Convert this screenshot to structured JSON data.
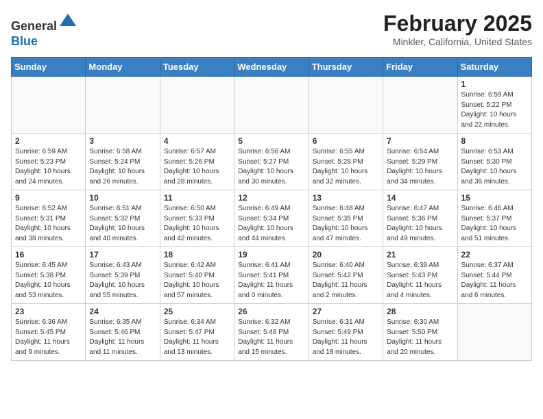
{
  "header": {
    "logo_general": "General",
    "logo_blue": "Blue",
    "month_title": "February 2025",
    "location": "Minkler, California, United States"
  },
  "days_of_week": [
    "Sunday",
    "Monday",
    "Tuesday",
    "Wednesday",
    "Thursday",
    "Friday",
    "Saturday"
  ],
  "weeks": [
    [
      {
        "day": "",
        "info": ""
      },
      {
        "day": "",
        "info": ""
      },
      {
        "day": "",
        "info": ""
      },
      {
        "day": "",
        "info": ""
      },
      {
        "day": "",
        "info": ""
      },
      {
        "day": "",
        "info": ""
      },
      {
        "day": "1",
        "info": "Sunrise: 6:59 AM\nSunset: 5:22 PM\nDaylight: 10 hours and 22 minutes."
      }
    ],
    [
      {
        "day": "2",
        "info": "Sunrise: 6:59 AM\nSunset: 5:23 PM\nDaylight: 10 hours and 24 minutes."
      },
      {
        "day": "3",
        "info": "Sunrise: 6:58 AM\nSunset: 5:24 PM\nDaylight: 10 hours and 26 minutes."
      },
      {
        "day": "4",
        "info": "Sunrise: 6:57 AM\nSunset: 5:26 PM\nDaylight: 10 hours and 28 minutes."
      },
      {
        "day": "5",
        "info": "Sunrise: 6:56 AM\nSunset: 5:27 PM\nDaylight: 10 hours and 30 minutes."
      },
      {
        "day": "6",
        "info": "Sunrise: 6:55 AM\nSunset: 5:28 PM\nDaylight: 10 hours and 32 minutes."
      },
      {
        "day": "7",
        "info": "Sunrise: 6:54 AM\nSunset: 5:29 PM\nDaylight: 10 hours and 34 minutes."
      },
      {
        "day": "8",
        "info": "Sunrise: 6:53 AM\nSunset: 5:30 PM\nDaylight: 10 hours and 36 minutes."
      }
    ],
    [
      {
        "day": "9",
        "info": "Sunrise: 6:52 AM\nSunset: 5:31 PM\nDaylight: 10 hours and 38 minutes."
      },
      {
        "day": "10",
        "info": "Sunrise: 6:51 AM\nSunset: 5:32 PM\nDaylight: 10 hours and 40 minutes."
      },
      {
        "day": "11",
        "info": "Sunrise: 6:50 AM\nSunset: 5:33 PM\nDaylight: 10 hours and 42 minutes."
      },
      {
        "day": "12",
        "info": "Sunrise: 6:49 AM\nSunset: 5:34 PM\nDaylight: 10 hours and 44 minutes."
      },
      {
        "day": "13",
        "info": "Sunrise: 6:48 AM\nSunset: 5:35 PM\nDaylight: 10 hours and 47 minutes."
      },
      {
        "day": "14",
        "info": "Sunrise: 6:47 AM\nSunset: 5:36 PM\nDaylight: 10 hours and 49 minutes."
      },
      {
        "day": "15",
        "info": "Sunrise: 6:46 AM\nSunset: 5:37 PM\nDaylight: 10 hours and 51 minutes."
      }
    ],
    [
      {
        "day": "16",
        "info": "Sunrise: 6:45 AM\nSunset: 5:38 PM\nDaylight: 10 hours and 53 minutes."
      },
      {
        "day": "17",
        "info": "Sunrise: 6:43 AM\nSunset: 5:39 PM\nDaylight: 10 hours and 55 minutes."
      },
      {
        "day": "18",
        "info": "Sunrise: 6:42 AM\nSunset: 5:40 PM\nDaylight: 10 hours and 57 minutes."
      },
      {
        "day": "19",
        "info": "Sunrise: 6:41 AM\nSunset: 5:41 PM\nDaylight: 11 hours and 0 minutes."
      },
      {
        "day": "20",
        "info": "Sunrise: 6:40 AM\nSunset: 5:42 PM\nDaylight: 11 hours and 2 minutes."
      },
      {
        "day": "21",
        "info": "Sunrise: 6:39 AM\nSunset: 5:43 PM\nDaylight: 11 hours and 4 minutes."
      },
      {
        "day": "22",
        "info": "Sunrise: 6:37 AM\nSunset: 5:44 PM\nDaylight: 11 hours and 6 minutes."
      }
    ],
    [
      {
        "day": "23",
        "info": "Sunrise: 6:36 AM\nSunset: 5:45 PM\nDaylight: 11 hours and 9 minutes."
      },
      {
        "day": "24",
        "info": "Sunrise: 6:35 AM\nSunset: 5:46 PM\nDaylight: 11 hours and 11 minutes."
      },
      {
        "day": "25",
        "info": "Sunrise: 6:34 AM\nSunset: 5:47 PM\nDaylight: 11 hours and 13 minutes."
      },
      {
        "day": "26",
        "info": "Sunrise: 6:32 AM\nSunset: 5:48 PM\nDaylight: 11 hours and 15 minutes."
      },
      {
        "day": "27",
        "info": "Sunrise: 6:31 AM\nSunset: 5:49 PM\nDaylight: 11 hours and 18 minutes."
      },
      {
        "day": "28",
        "info": "Sunrise: 6:30 AM\nSunset: 5:50 PM\nDaylight: 11 hours and 20 minutes."
      },
      {
        "day": "",
        "info": ""
      }
    ]
  ]
}
